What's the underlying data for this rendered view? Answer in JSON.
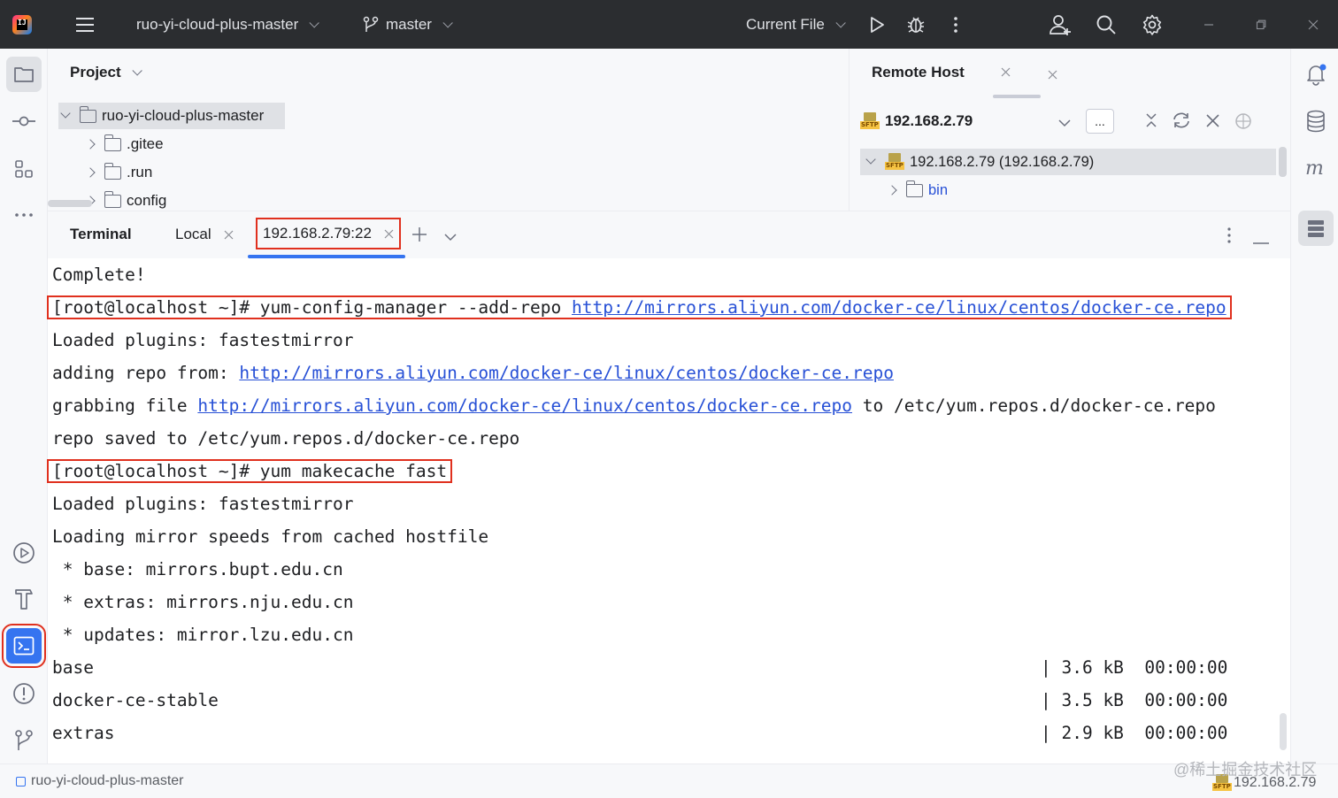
{
  "titlebar": {
    "project_name": "ruo-yi-cloud-plus-master",
    "branch": "master",
    "run_config": "Current File"
  },
  "project_panel": {
    "title": "Project",
    "tree": [
      {
        "label": "ruo-yi-cloud-plus-master",
        "expanded": true,
        "level": 0
      },
      {
        "label": ".gitee",
        "expanded": false,
        "level": 1
      },
      {
        "label": ".run",
        "expanded": false,
        "level": 1
      },
      {
        "label": "config",
        "expanded": false,
        "level": 1
      }
    ]
  },
  "remote_panel": {
    "title": "Remote Host",
    "host": "192.168.2.79",
    "more_button": "...",
    "tree": [
      {
        "label": "192.168.2.79 (192.168.2.79)",
        "expanded": true
      },
      {
        "label": "bin",
        "expanded": false
      }
    ]
  },
  "terminal": {
    "title": "Terminal",
    "tabs": [
      {
        "label": "Local",
        "active": false
      },
      {
        "label": "192.168.2.79:22",
        "active": true
      }
    ],
    "lines": {
      "l1": "Complete!",
      "l2_prompt": "[root@localhost ~]# yum-config-manager --add-repo ",
      "l2_url": "http://mirrors.aliyun.com/docker-ce/linux/centos/docker-ce.repo",
      "l3": "Loaded plugins: fastestmirror",
      "l4_text": "adding repo from: ",
      "l4_url": "http://mirrors.aliyun.com/docker-ce/linux/centos/docker-ce.repo",
      "l5_text": "grabbing file ",
      "l5_url": "http://mirrors.aliyun.com/docker-ce/linux/centos/docker-ce.repo",
      "l5_tail": " to /etc/yum.repos.d/docker-ce.repo",
      "l6": "repo saved to /etc/yum.repos.d/docker-ce.repo",
      "l7": "[root@localhost ~]# yum makecache fast",
      "l8": "Loaded plugins: fastestmirror",
      "l9": "Loading mirror speeds from cached hostfile",
      "l10": " * base: mirrors.bupt.edu.cn",
      "l11": " * extras: mirrors.nju.edu.cn",
      "l12": " * updates: mirror.lzu.edu.cn",
      "r1_name": "base",
      "r1_stats": "| 3.6 kB  00:00:00",
      "r2_name": "docker-ce-stable",
      "r2_stats": "| 3.5 kB  00:00:00",
      "r3_name": "extras",
      "r3_stats": "| 2.9 kB  00:00:00"
    }
  },
  "statusbar": {
    "project": "ruo-yi-cloud-plus-master",
    "host": "192.168.2.79"
  },
  "watermark": "@稀土掘金技术社区",
  "colors": {
    "titlebar_bg": "#2b2d30",
    "accent": "#3574f0",
    "link": "#2750d6",
    "highlight_box": "#e0301e"
  }
}
